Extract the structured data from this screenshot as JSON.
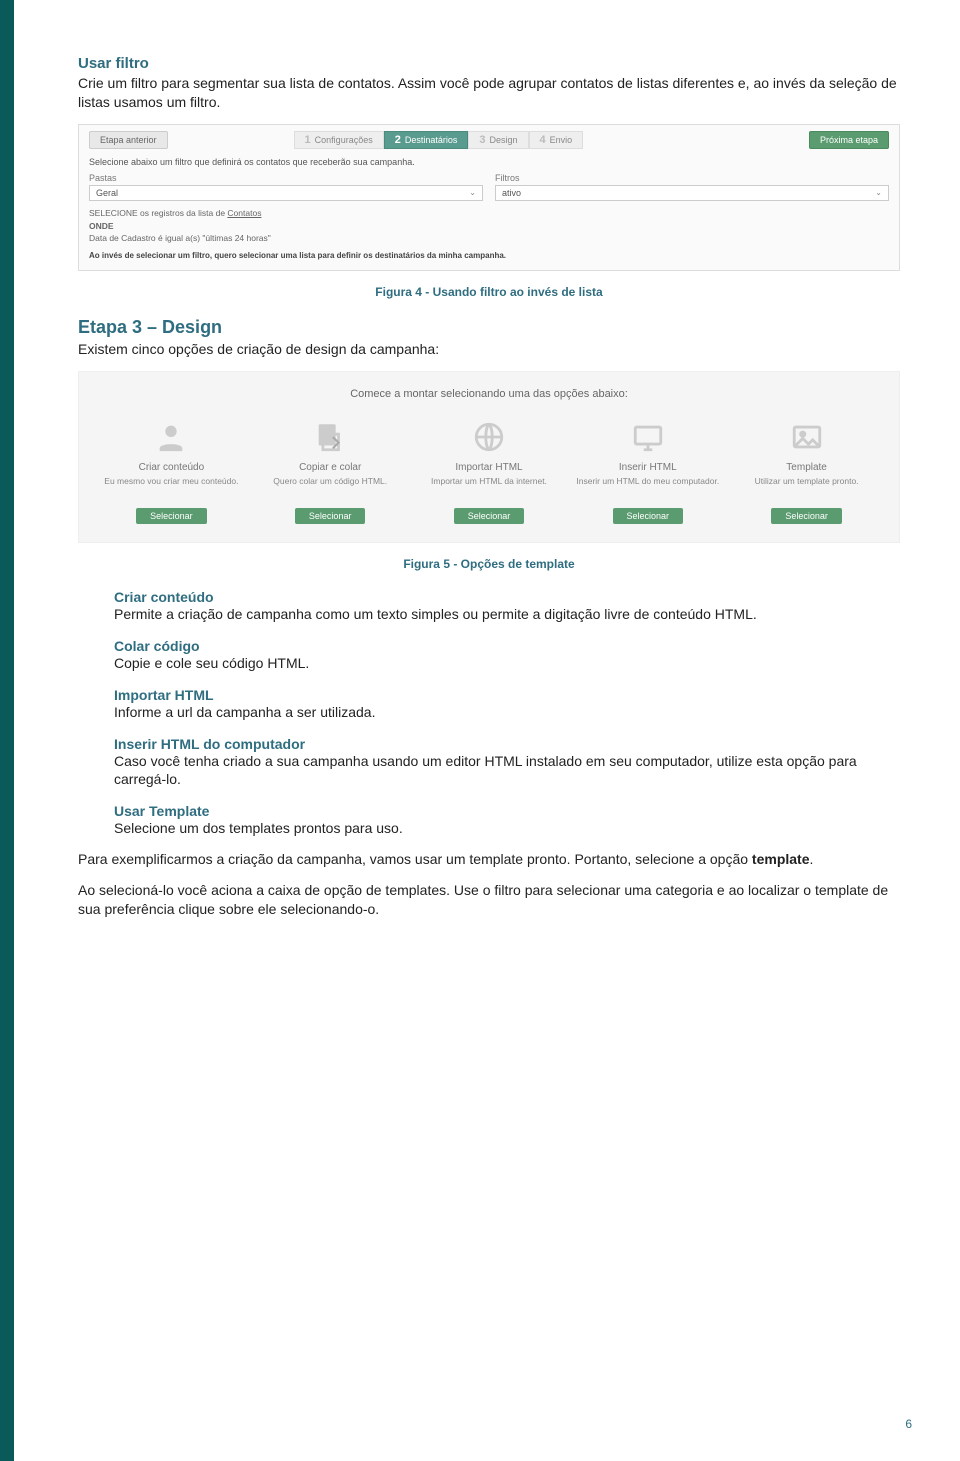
{
  "section1": {
    "head": "Usar filtro",
    "body": "Crie um filtro para segmentar sua lista de contatos. Assim você pode agrupar contatos de listas diferentes e, ao invés da seleção de listas usamos um filtro."
  },
  "fig4": {
    "prev_btn": "Etapa anterior",
    "next_btn": "Próxima etapa",
    "steps": {
      "s1": {
        "num": "1",
        "label": "Configurações"
      },
      "s2": {
        "num": "2",
        "label": "Destinatários"
      },
      "s3": {
        "num": "3",
        "label": "Design"
      },
      "s4": {
        "num": "4",
        "label": "Envio"
      }
    },
    "instruction": "Selecione abaixo um filtro que definirá os contatos que receberão sua campanha.",
    "pastas_label": "Pastas",
    "pastas_value": "Geral",
    "filtros_label": "Filtros",
    "filtros_value": "ativo",
    "sel_line1a": "SELECIONE os registros da lista de ",
    "sel_line1b": "Contatos",
    "onde": "ONDE",
    "sel_line2": "Data de Cadastro é igual a(s) \"últimas 24 horas\"",
    "note": "Ao invés de selecionar um filtro, quero selecionar uma lista para definir os destinatários da minha campanha."
  },
  "caption4": "Figura 4 - Usando filtro ao invés de lista",
  "etapa3": {
    "head": "Etapa 3 – Design",
    "body": "Existem cinco opções de criação de design da campanha:"
  },
  "fig5": {
    "head": "Comece a montar selecionando uma das opções abaixo:",
    "opts": [
      {
        "title": "Criar conteúdo",
        "desc": "Eu mesmo vou criar meu conteúdo.",
        "btn": "Selecionar"
      },
      {
        "title": "Copiar e colar",
        "desc": "Quero colar um código HTML.",
        "btn": "Selecionar"
      },
      {
        "title": "Importar HTML",
        "desc": "Importar um HTML da internet.",
        "btn": "Selecionar"
      },
      {
        "title": "Inserir HTML",
        "desc": "Inserir um HTML do meu computador.",
        "btn": "Selecionar"
      },
      {
        "title": "Template",
        "desc": "Utilizar um template pronto.",
        "btn": "Selecionar"
      }
    ]
  },
  "caption5": "Figura 5 - Opções de template",
  "subs": {
    "criar": {
      "head": "Criar conteúdo",
      "body": "Permite a criação de campanha como um texto simples ou permite a digitação livre de conteúdo HTML."
    },
    "colar": {
      "head": "Colar código",
      "body": "Copie e cole seu código HTML."
    },
    "importar": {
      "head": "Importar HTML",
      "body": "Informe a url da campanha a ser utilizada."
    },
    "inserir": {
      "head": "Inserir HTML do computador",
      "body": "Caso você tenha criado a sua campanha usando um editor HTML instalado em seu computador, utilize esta opção para carregá-lo."
    },
    "usar": {
      "head": "Usar Template",
      "body": "Selecione um dos templates prontos para uso."
    }
  },
  "para_exemplo1": "Para exemplificarmos a criação da campanha, vamos usar um template pronto. Portanto, selecione a opção ",
  "para_exemplo_bold": "template",
  "para_exemplo2": ".",
  "para_seleciona": "Ao selecioná-lo você aciona a caixa de opção de templates. Use o filtro para selecionar uma categoria e ao localizar o template de sua preferência clique sobre ele selecionando-o.",
  "page_num": "6"
}
